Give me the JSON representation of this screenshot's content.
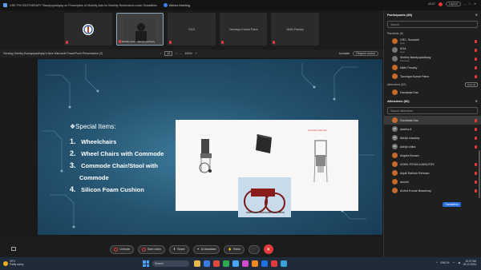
{
  "window": {
    "title": "CRE 'PHYSIOTHERAPY' Bandyopadhyay on Prescription of Mobility Aids for Mobility Restrictions under Disabilities",
    "app_label": "Webex Meeting",
    "time": "43:47",
    "layout_label": "Layout"
  },
  "thumbnails": [
    {
      "name": "",
      "type": "logo"
    },
    {
      "name": "Mobility Aids... Bandyopadhyay",
      "type": "camera"
    },
    {
      "name": "SGS"
    },
    {
      "name": "Tanmaya Kumar Patra"
    },
    {
      "name": "Nidhi Pandey"
    }
  ],
  "share_bar": {
    "text": "Viewing Shelley Bandyopadhyay's New Microsoft PowerPoint Presentation (2)",
    "page": "10",
    "zoom": "100%",
    "annotate": "Annotate",
    "request": "Request control"
  },
  "slide": {
    "heading": "Special Items:",
    "items": [
      {
        "num": "1.",
        "text": "Wheelchairs"
      },
      {
        "num": "2.",
        "text": "Wheel Chairs with Commode"
      },
      {
        "num": "3.",
        "text": "Commode Chair/Stool with",
        "cont": "Commode"
      },
      {
        "num": "4.",
        "text": "Silicon Foam Cushion"
      }
    ],
    "commode_label": "Commode Chair with"
  },
  "toolbar": {
    "unmute": "Unmute",
    "start_video": "Start video",
    "share": "Share",
    "ai_assistant": "AI Assistant",
    "raise": "Raise",
    "end": "✕"
  },
  "panel": {
    "participants_title": "Participants (86)",
    "search_placeholder": "Search",
    "panelists_group": "Panelists (5)",
    "panelists": [
      {
        "initials": "",
        "name": "CRC, Sundarki",
        "sub": "Host"
      },
      {
        "initials": "",
        "name": "KOA",
        "sub": "Host"
      },
      {
        "initials": "",
        "name": "Shelley Bandyopadhyay",
        "sub": "Presenter"
      },
      {
        "initials": "",
        "name": "Nidhi Pandey",
        "sub": ""
      },
      {
        "initials": "",
        "name": "Tanmaya Kumar Patra",
        "sub": ""
      }
    ],
    "attendees_group": "Attendees (82)",
    "view_all": "View all",
    "attendee_top": {
      "name": "Dandaula Das"
    },
    "attendees_title": "Attendees (82)",
    "search_attendees": "Search attendees",
    "attendees": [
      {
        "initials": "",
        "name": "Dandaula Das"
      },
      {
        "initials": "AA",
        "name": "Aastha A"
      },
      {
        "initials": "AC",
        "name": "Abhijit chaubey"
      },
      {
        "initials": "AC",
        "name": "Abhijit chiba"
      },
      {
        "initials": "",
        "name": "Angela Bonam"
      },
      {
        "initials": "",
        "name": "ASHIK FROM A MINUTES"
      },
      {
        "initials": "",
        "name": "Anjali Rathish Rehman"
      },
      {
        "initials": "",
        "name": "anushi"
      },
      {
        "initials": "",
        "name": "Arvind Kumar Beautmay"
      }
    ],
    "tooltip": "Translation"
  },
  "taskbar": {
    "weather_temp": "29°C",
    "weather_text": "Partly sunny",
    "search": "Search",
    "time": "10:07 AM",
    "date": "03-12-2024",
    "lang": "ENG IN"
  },
  "colors": {
    "accent": "#3b82f6",
    "end_red": "#e23b3b",
    "slide_bg": "#24536f"
  }
}
